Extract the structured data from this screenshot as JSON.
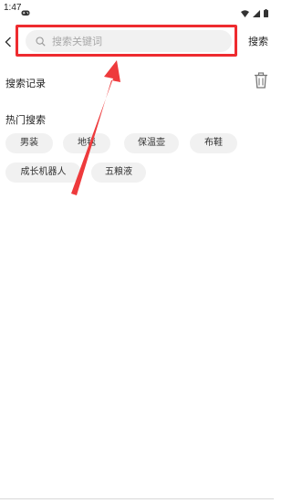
{
  "status_bar": {
    "time": "1:47"
  },
  "search": {
    "placeholder": "搜索关键词",
    "submit_label": "搜索"
  },
  "history": {
    "title": "搜索记录"
  },
  "hot": {
    "title": "热门搜索",
    "tags": [
      {
        "label": "男装"
      },
      {
        "label": "地毯"
      },
      {
        "label": "保温壶"
      },
      {
        "label": "布鞋"
      },
      {
        "label": "成长机器人"
      },
      {
        "label": "五粮液"
      }
    ]
  },
  "icons": {
    "back": "chevron-left-icon",
    "search": "search-icon",
    "delete": "trash-icon",
    "gamepad": "gamepad-icon",
    "wifi": "wifi-icon",
    "signal": "cell-signal-icon",
    "battery": "battery-icon"
  },
  "colors": {
    "annotation": "#ee2b2f",
    "tag_background": "#f1f1f1",
    "search_background": "#f1f1f1"
  }
}
